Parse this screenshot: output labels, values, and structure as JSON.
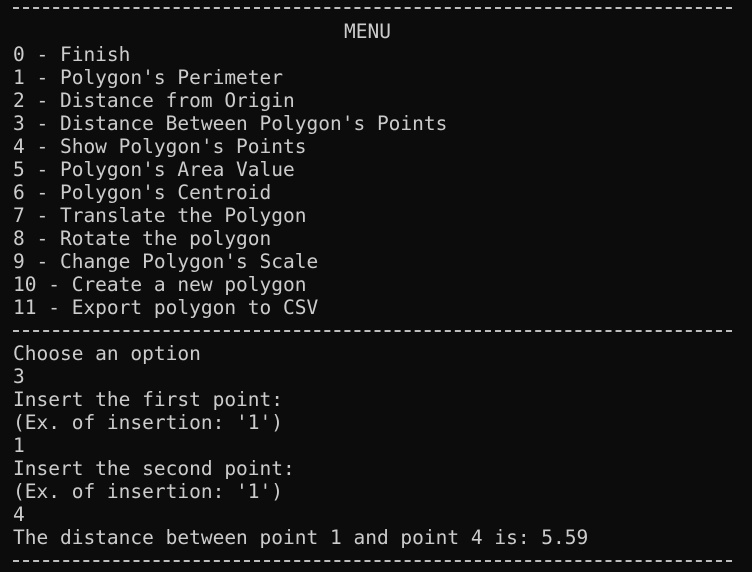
{
  "menu": {
    "title": "MENU",
    "options": [
      "0 - Finish",
      "1 - Polygon's Perimeter",
      "2 - Distance from Origin",
      "3 - Distance Between Polygon's Points",
      "4 - Show Polygon's Points",
      "5 - Polygon's Area Value",
      "6 - Polygon's Centroid",
      "7 - Translate the Polygon",
      "8 - Rotate the polygon",
      "9 - Change Polygon's Scale",
      "10 - Create a new polygon",
      "11 - Export polygon to CSV"
    ]
  },
  "session": {
    "prompt": "Choose an option",
    "option_input": "3",
    "first_point_prompt": "Insert the first point:",
    "first_point_example": "(Ex. of insertion: '1')",
    "first_point_input": "1",
    "second_point_prompt": "Insert the second point:",
    "second_point_example": "(Ex. of insertion: '1')",
    "second_point_input": "4",
    "result": "The distance between point 1 and point 4 is: 5.59"
  }
}
